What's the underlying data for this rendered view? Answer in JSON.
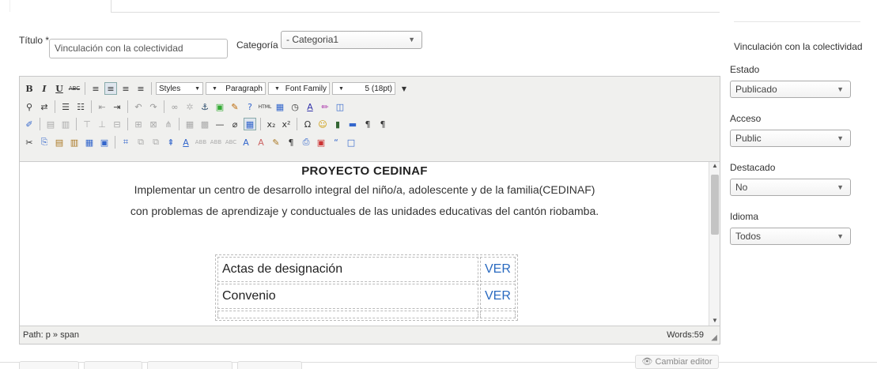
{
  "form": {
    "title_label": "Título",
    "title_required": "*",
    "title_value": "Vinculación con la colectividad",
    "category_label": "Categoría",
    "category_required": "*",
    "category_value": "- Categoria1"
  },
  "toolbar": {
    "styles": "Styles",
    "format": "Paragraph",
    "font_family": "Font Family",
    "font_size": "5 (18pt)"
  },
  "content": {
    "heading": "PROYECTO CEDINAF",
    "line1": "Implementar un centro de desarrollo integral del niño/a, adolescente y de la familia(CEDINAF)",
    "line2": "con problemas de aprendizaje y conductuales de las unidades educativas del cantón riobamba.",
    "table": [
      {
        "title": "Actas de designación",
        "link": "VER"
      },
      {
        "title": "Convenio",
        "link": "VER"
      }
    ]
  },
  "statusbar": {
    "path": "Path: p » span",
    "words": "Words:59"
  },
  "footer": {
    "switch_editor": "Cambiar editor"
  },
  "sidebar": {
    "title": "Vinculación con la colectividad",
    "estado_label": "Estado",
    "estado_value": "Publicado",
    "acceso_label": "Acceso",
    "acceso_value": "Public",
    "destacado_label": "Destacado",
    "destacado_value": "No",
    "idioma_label": "Idioma",
    "idioma_value": "Todos"
  },
  "colors": {
    "link": "#2a6ac0",
    "toolbar_bg": "#f0f0ee"
  }
}
